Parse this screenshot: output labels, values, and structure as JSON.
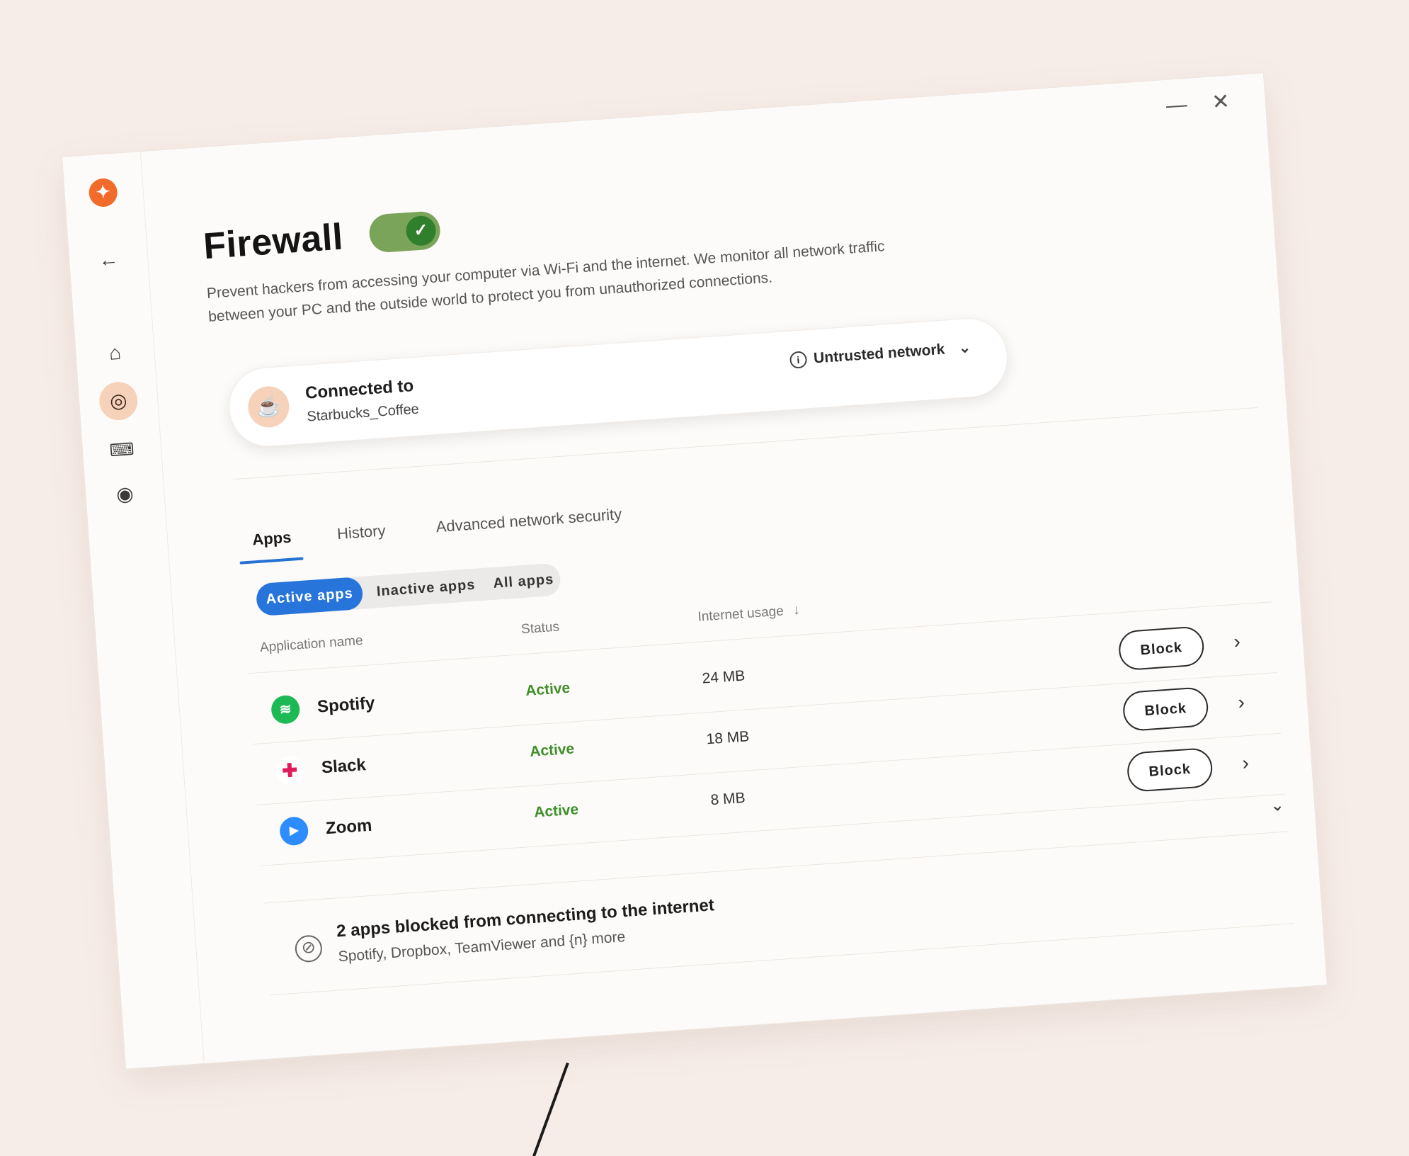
{
  "window": {
    "minimize_glyph": "—",
    "close_glyph": "✕"
  },
  "sidebar": {
    "logo_icon": "avast-logo",
    "back_icon": "back-arrow-icon",
    "items": [
      {
        "icon": "home-icon",
        "glyph": "⌂"
      },
      {
        "icon": "compass-icon",
        "glyph": "◎",
        "active": true
      },
      {
        "icon": "chat-icon",
        "glyph": "💬"
      },
      {
        "icon": "account-icon",
        "glyph": "◉"
      }
    ]
  },
  "header": {
    "title": "Firewall",
    "toggle_on": true,
    "description": "Prevent hackers from accessing your computer via Wi-Fi and the internet. We monitor all network traffic between your PC and the outside world to protect you from unauthorized connections."
  },
  "connection": {
    "label": "Connected to",
    "ssid": "Starbucks_Coffee",
    "network_status": "Untrusted network"
  },
  "tabs": [
    {
      "label": "Apps",
      "active": true
    },
    {
      "label": "History",
      "active": false
    },
    {
      "label": "Advanced network security",
      "active": false
    }
  ],
  "filters": [
    {
      "label": "Active apps",
      "active": true
    },
    {
      "label": "Inactive apps",
      "active": false
    },
    {
      "label": "All apps",
      "active": false
    }
  ],
  "table": {
    "columns": [
      "Application name",
      "Status",
      "Internet usage"
    ],
    "sort_icon": "arrow-down-icon",
    "rows": [
      {
        "name": "Spotify",
        "status": "Active",
        "usage": "24 MB",
        "action": "Block",
        "icon_color": "#1db954"
      },
      {
        "name": "Slack",
        "status": "Active",
        "usage": "18 MB",
        "action": "Block",
        "icon_color": "#e01e5a"
      },
      {
        "name": "Zoom",
        "status": "Active",
        "usage": "8 MB",
        "action": "Block",
        "icon_color": "#2d8cff"
      }
    ]
  },
  "blocked": {
    "title": "2 apps blocked from connecting to the internet",
    "subtitle": "Spotify, Dropbox, TeamViewer and {n} more"
  },
  "colors": {
    "accent": "#2775db",
    "toggle_on": "#7ba45b",
    "status_active": "#3f8f2a",
    "brand": "#f26b2a",
    "background": "#f7ede8"
  }
}
